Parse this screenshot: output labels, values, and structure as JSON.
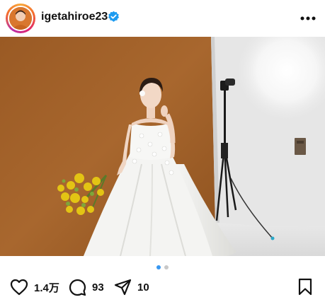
{
  "post": {
    "username": "igetahiroe23",
    "verified": true
  },
  "image": {
    "dominant_colors": {
      "backdrop_brown": "#a0602a",
      "studio_wall": "#ececec",
      "dress": "#f4f4f2",
      "flowers": "#e3c414"
    },
    "carousel": {
      "count": 2,
      "active_index": 0
    }
  },
  "actions": {
    "likes": "1.4万",
    "comments": "93",
    "shares": "10"
  },
  "colors": {
    "accent_blue": "#3897f0",
    "verified_blue": "#1d9bf0",
    "text": "#111111"
  }
}
